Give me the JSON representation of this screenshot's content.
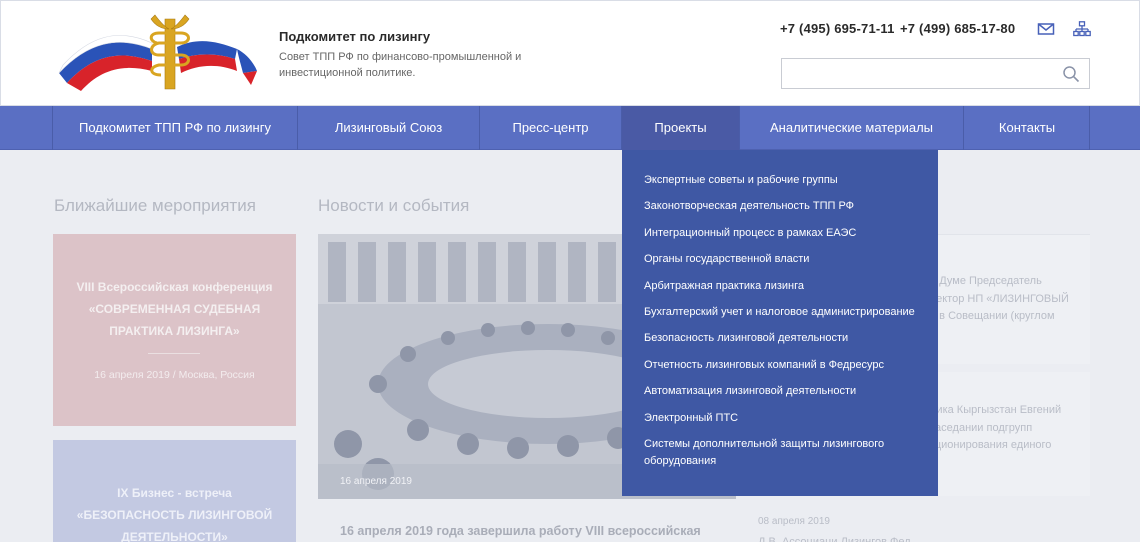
{
  "header": {
    "title": "Подкомитет по лизингу",
    "subtitle": "Совет ТПП РФ по финансово-промышленной и инвестиционной политике.",
    "phone1": "+7 (495) 695-71-11",
    "phone2": "+7 (499) 685-17-80",
    "search_placeholder": "",
    "icons": {
      "mail": "mail-icon",
      "sitemap": "sitemap-icon",
      "search": "search-icon",
      "logo": "ttp-emblem-logo"
    }
  },
  "nav": {
    "items": [
      {
        "label": "Подкомитет ТПП РФ по лизингу"
      },
      {
        "label": "Лизинговый Союз"
      },
      {
        "label": "Пресс-центр"
      },
      {
        "label": "Проекты",
        "active": true
      },
      {
        "label": "Аналитические материалы"
      },
      {
        "label": "Контакты"
      }
    ]
  },
  "dropdown": {
    "items": [
      "Экспертные советы и рабочие группы",
      "Законотворческая деятельность ТПП РФ",
      "Интеграционный процесс в рамках ЕАЭС",
      "Органы государственной власти",
      "Арбитражная практика лизинга",
      "Бухгалтерский учет и налоговое администрирование",
      "Безопасность лизинговой деятельности",
      "Отчетность лизинговых компаний в Федресурс",
      "Автоматизация лизинговой деятельности",
      "Электронный ПТС",
      "Системы дополнительной защиты лизингового оборудования"
    ]
  },
  "events": {
    "title": "Ближайшие мероприятия",
    "cards": [
      {
        "title": "VIII Всероссийская конференция «СОВРЕМЕННАЯ СУДЕБНАЯ ПРАКТИКА ЛИЗИНГА»",
        "date": "16 апреля 2019",
        "place": "Москва, Россия"
      },
      {
        "title": "IX Бизнес - встреча «БЕЗОПАСНОСТЬ ЛИЗИНГОВОЙ ДЕЯТЕЛЬНОСТИ»"
      }
    ]
  },
  "news": {
    "title": "Новости и события",
    "photo_date": "16 апреля 2019",
    "headline": "16 апреля 2019 года завершила работу VIII всероссийская",
    "side": [
      {
        "text": "й Думе Председатель\nректор НП «ЛИЗИНГОВЫЙ\nе в Совещании (круглом"
      },
      {
        "text": "лика Кыргызстан Евгений\nзаседании подгрупп\nкционирования единого"
      }
    ],
    "side_date": "08 апреля 2019",
    "side_next": "Д.В. Ассоциаци Лизингов Фед..."
  }
}
